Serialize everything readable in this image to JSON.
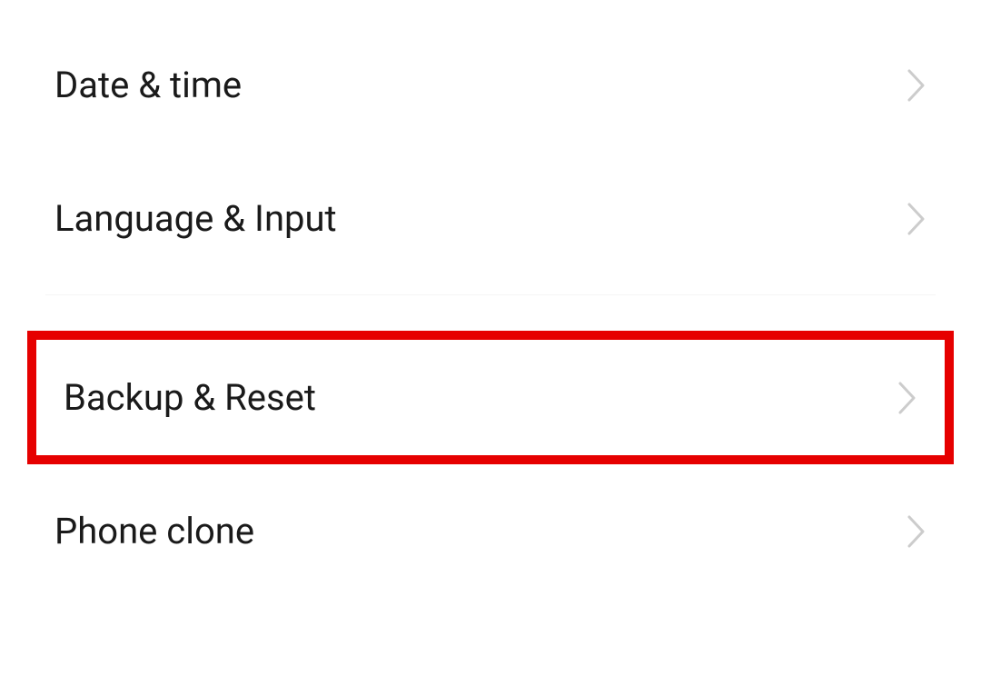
{
  "settings": {
    "items": [
      {
        "label": "Date & time"
      },
      {
        "label": "Language & Input"
      },
      {
        "label": "Backup & Reset"
      },
      {
        "label": "Phone clone"
      }
    ]
  },
  "highlight": {
    "color": "#e60000"
  }
}
